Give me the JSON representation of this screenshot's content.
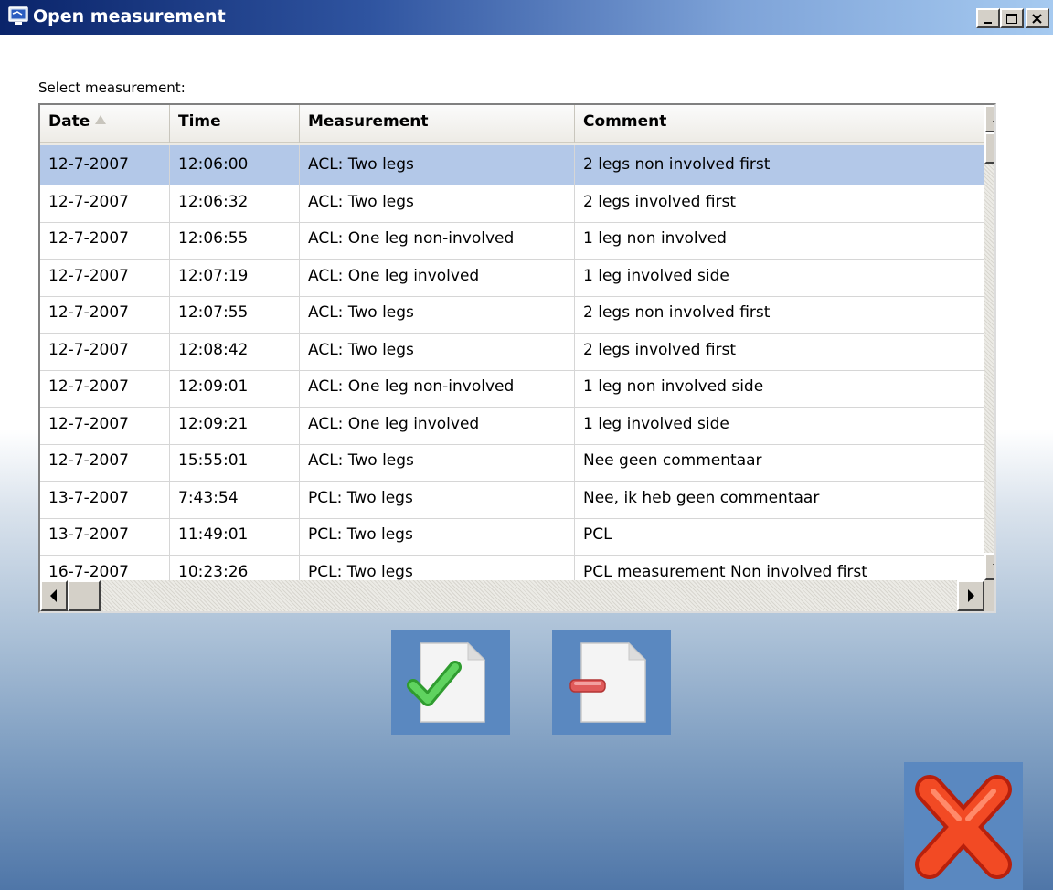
{
  "window": {
    "title": "Open measurement",
    "controls": [
      "minimize-icon",
      "maximize-icon",
      "close-icon"
    ]
  },
  "prompt": "Select measurement:",
  "table": {
    "columns": [
      "Date",
      "Time",
      "Measurement",
      "Comment"
    ],
    "sort_column": "Date",
    "sort_direction": "ascending",
    "selected_row": 0,
    "rows": [
      [
        "12-7-2007",
        "12:06:00",
        "ACL: Two legs",
        "2 legs non involved first"
      ],
      [
        "12-7-2007",
        "12:06:32",
        "ACL: Two legs",
        "2 legs involved first"
      ],
      [
        "12-7-2007",
        "12:06:55",
        "ACL: One leg non-involved",
        "1 leg non involved"
      ],
      [
        "12-7-2007",
        "12:07:19",
        "ACL: One leg involved",
        "1 leg involved side"
      ],
      [
        "12-7-2007",
        "12:07:55",
        "ACL: Two legs",
        "2 legs non involved first"
      ],
      [
        "12-7-2007",
        "12:08:42",
        "ACL: Two legs",
        "2 legs involved first"
      ],
      [
        "12-7-2007",
        "12:09:01",
        "ACL: One leg non-involved",
        "1 leg non involved side"
      ],
      [
        "12-7-2007",
        "12:09:21",
        "ACL: One leg involved",
        "1 leg involved side"
      ],
      [
        "12-7-2007",
        "15:55:01",
        "ACL: Two legs",
        "Nee geen commentaar"
      ],
      [
        "13-7-2007",
        "7:43:54",
        "PCL: Two legs",
        "Nee, ik heb geen commentaar"
      ],
      [
        "13-7-2007",
        "11:49:01",
        "PCL: Two legs",
        "PCL"
      ],
      [
        "16-7-2007",
        "10:23:26",
        "PCL: Two legs",
        "PCL measurement Non involved first"
      ]
    ]
  },
  "actions": {
    "open_icon": "document-check-icon",
    "delete_icon": "document-remove-icon",
    "cancel_icon": "cancel-x-icon"
  },
  "colors": {
    "selection": "#b3c8e8",
    "action_button": "#5a88c0",
    "check": "#3cb43c",
    "cancel": "#ee3d1f"
  }
}
